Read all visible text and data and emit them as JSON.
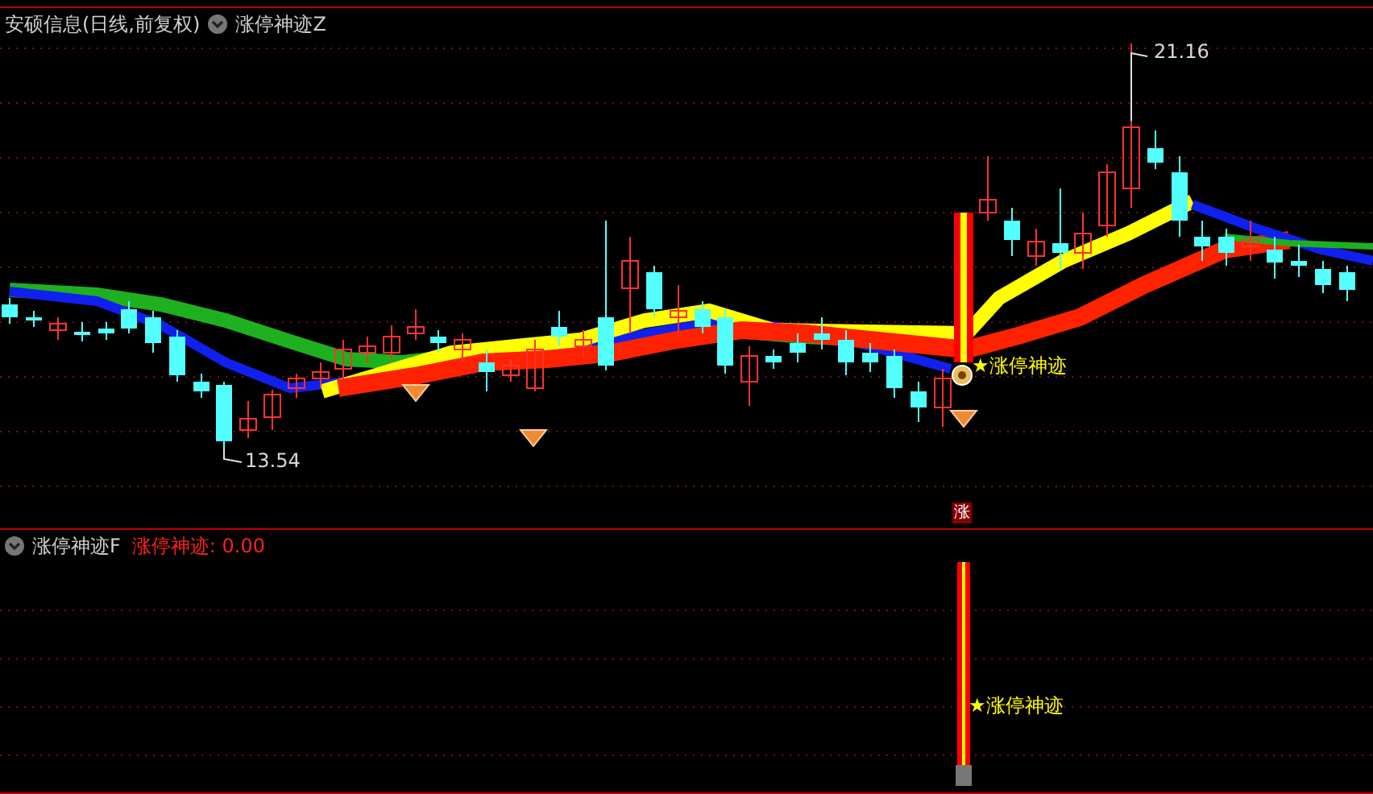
{
  "main_pane": {
    "title": "安硕信息(日线,前复权)",
    "indicator": "涨停神迹Z",
    "high_label": "21.16",
    "low_label": "13.54",
    "signal_label": "★涨停神迹"
  },
  "signal_badge": "涨",
  "sub_pane": {
    "indicator": "涨停神迹F",
    "value_label": "涨停神迹: 0.00",
    "signal_label": "★涨停神迹"
  }
}
